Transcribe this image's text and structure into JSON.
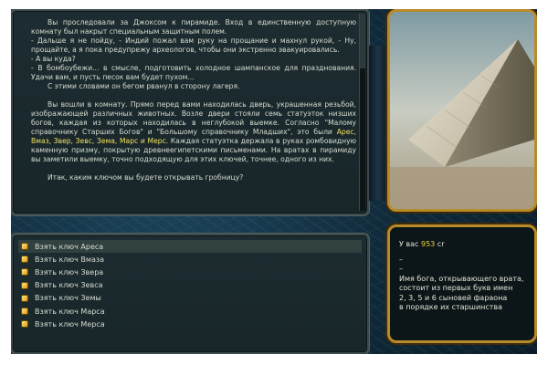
{
  "story": {
    "paragraph_1": "Вы проследовали за Джоксом к пирамиде. Вход в единственную доступную комнату был накрыт специальным защитным полем.",
    "line_2": "- Дальше я не пойду, - Индий пожал вам руку на прощание и махнул рукой, - Ну, прощайте, а я пока предупрежу археологов, чтобы они экстренно эвакуировались.",
    "line_3": "- А вы куда?",
    "line_4": "- В бомбоубежи... в смысле, подготовить холодное шампанское для празднования. Удачи вам, и пусть песок вам будет пухом...",
    "line_5": "С этими словами он бегом рванул в сторону лагеря.",
    "paragraph_2_part1": "Вы вошли в комнату. Прямо перед вами находилась дверь, украшенная резьбой, изображающей различных животных. Возле двери стояли семь статуэток низших богов, каждая из которых находилась в неглубокой выемке. Согласно \"Малому справочнику Старших Богов\" и \"Большому справочнику Младших\", это были ",
    "gods_highlight": "Арес, Вмаз, Звер, Зевс, Зема, Марс и Мерс",
    "paragraph_2_part2": ". Каждая статуэтка держала в руках ромбовидную каменную призму, покрытую древнеегипетскими письменами. На вратах в пирамиду вы заметили выемку, точно подходящую для этих ключей, точнее, одного из них.",
    "question": "Итак, каким ключом вы будете открывать гробницу?"
  },
  "choices": [
    {
      "label": "Взять ключ Ареса"
    },
    {
      "label": "Взять ключ Вмаза"
    },
    {
      "label": "Взять ключ Звера"
    },
    {
      "label": "Взять ключ Зевса"
    },
    {
      "label": "Взять ключ Земы"
    },
    {
      "label": "Взять ключ Марса"
    },
    {
      "label": "Взять ключ Мерса"
    }
  ],
  "info": {
    "money_prefix": "У вас ",
    "money_value": "953",
    "money_unit": " cr",
    "dash_1": "–",
    "dash_2": "–",
    "hint_1": "Имя бога, открывающего врата,",
    "hint_2": "состоит из первых букв имен",
    "hint_3": "2, 3, 5 и 6 сыновей фараона",
    "hint_4": "в порядке их старшинства"
  },
  "colors": {
    "highlight": "#f0e060",
    "money": "#f0d040",
    "frame_gold": "#b78a2a"
  },
  "icons": {
    "choice_bullet": "gold-square-bullet-icon",
    "picture": "pyramid-image"
  }
}
